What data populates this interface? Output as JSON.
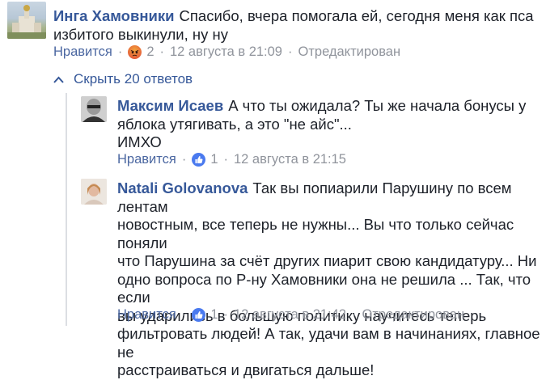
{
  "comments": [
    {
      "author": "Инга Хамовники",
      "lines": [
        "Спасибо, вчера помогала ей, сегодня меня как пса",
        "избитого выкинули, ну ну"
      ],
      "like_label": "Нравится",
      "reaction_icon": "angry-icon",
      "reaction_count": "2",
      "time": "12 августа в 21:09",
      "edited": "Отредактирован"
    },
    {
      "author": "Максим Исаев",
      "lines": [
        "А что ты ожидала? Ты же начала бонусы у",
        "яблока утягивать, а это \"не айс\"...",
        "ИМХО"
      ],
      "like_label": "Нравится",
      "reaction_icon": "like-icon",
      "reaction_count": "1",
      "time": "12 августа в 21:15"
    },
    {
      "author": "Natali Golovanova",
      "lines": [
        "Так вы попиарили Парушину по всем лентам",
        "новостным, все теперь не нужны... Вы что только сейчас поняли",
        "что Парушина за счёт других пиарит свою кандидатуру... Ни",
        "одно вопроса по Р-ну Хамовники она не решила ... Так, что если",
        "вы ударились в большую политику научитесь теперь",
        "фильтровать людей! А так, удачи вам в начинаниях, главное не",
        "расстраиваться и двигаться дальше!"
      ],
      "like_label": "Нравится",
      "reaction_icon": "like-icon",
      "reaction_count": "1",
      "time": "12 августа в 21:42",
      "edited": "Отредактирован"
    }
  ],
  "replies_toggle": {
    "label": "Скрыть 20 ответов",
    "icon": "chevron-up-icon"
  },
  "colors": {
    "link": "#365899",
    "meta": "#90949c",
    "text": "#1d2129"
  }
}
